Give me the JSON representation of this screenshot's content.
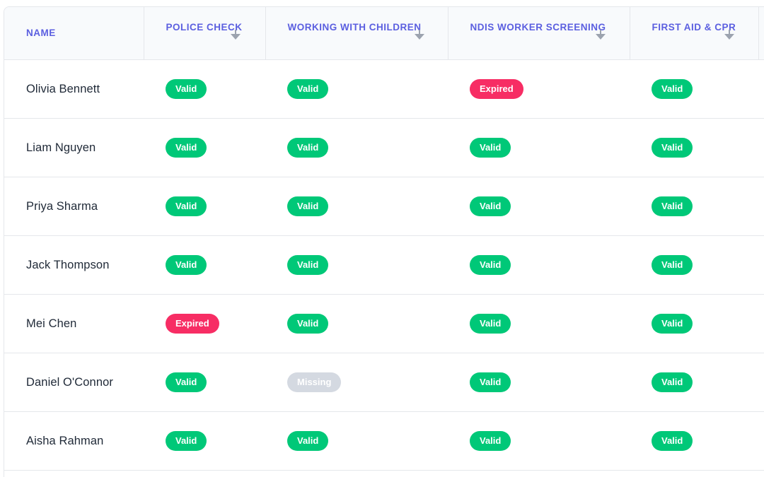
{
  "table": {
    "headers": {
      "name": "NAME",
      "police": "POLICE CHECK",
      "wwc": "WORKING WITH CHILDREN",
      "ndis": "NDIS WORKER SCREENING",
      "first_aid": "FIRST AID & CPR"
    },
    "rows": [
      {
        "name": "Olivia Bennett",
        "police": "Valid",
        "wwc": "Valid",
        "ndis": "Expired",
        "first_aid": "Valid"
      },
      {
        "name": "Liam Nguyen",
        "police": "Valid",
        "wwc": "Valid",
        "ndis": "Valid",
        "first_aid": "Valid"
      },
      {
        "name": "Priya Sharma",
        "police": "Valid",
        "wwc": "Valid",
        "ndis": "Valid",
        "first_aid": "Valid"
      },
      {
        "name": "Jack Thompson",
        "police": "Valid",
        "wwc": "Valid",
        "ndis": "Valid",
        "first_aid": "Valid"
      },
      {
        "name": "Mei Chen",
        "police": "Expired",
        "wwc": "Valid",
        "ndis": "Valid",
        "first_aid": "Valid"
      },
      {
        "name": "Daniel O'Connor",
        "police": "Valid",
        "wwc": "Missing",
        "ndis": "Valid",
        "first_aid": "Valid"
      },
      {
        "name": "Aisha Rahman",
        "police": "Valid",
        "wwc": "Valid",
        "ndis": "Valid",
        "first_aid": "Valid"
      }
    ]
  },
  "colors": {
    "valid": "#00c878",
    "expired": "#f72d64",
    "missing": "#d4d9e1",
    "header_text": "#5b5fe0"
  },
  "icons": {
    "sort": "sort-descending-icon"
  }
}
